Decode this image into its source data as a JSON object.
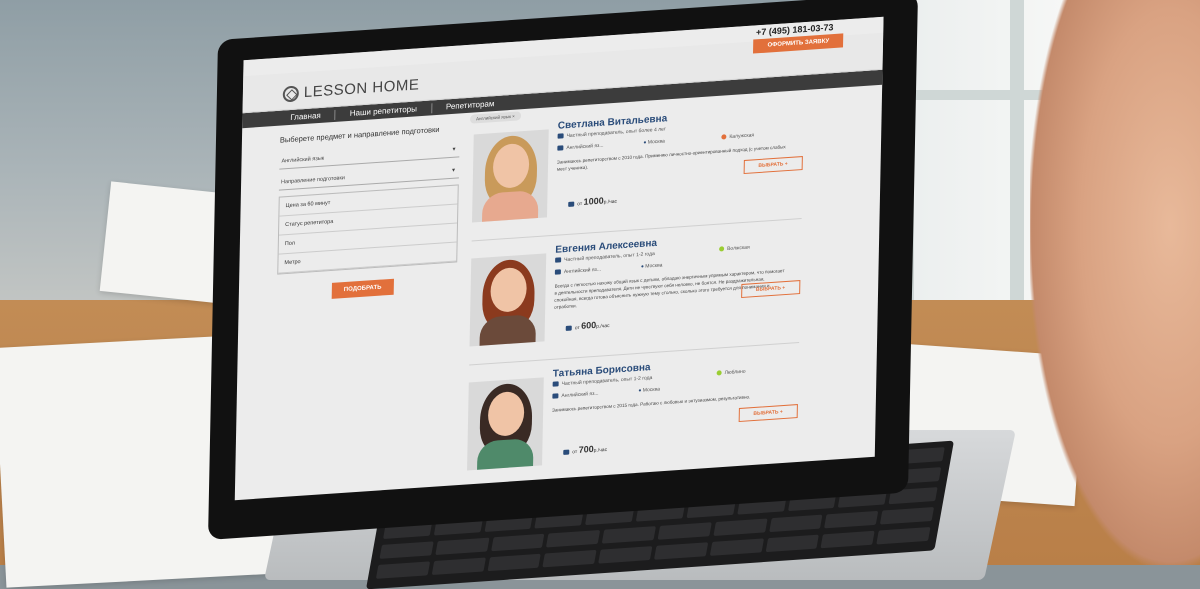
{
  "site": {
    "phone": "+7 (495) 181-03-73",
    "cta_label": "ОФОРМИТЬ ЗАЯВКУ",
    "logo_text": "LESSON HOME",
    "nav": [
      "Главная",
      "Наши репетиторы",
      "Репетиторам"
    ]
  },
  "filter": {
    "title": "Выберете предмет и направление подготовки",
    "subject_value": "Английский язык",
    "direction_placeholder": "Направление подготовки",
    "fields": [
      "Цена за 60 минут",
      "Статус репетитора",
      "Пол",
      "Метро"
    ],
    "submit_label": "ПОДОБРАТЬ",
    "chip_label": "Английский язык ×"
  },
  "tutors": [
    {
      "name": "Светлана Витальевна",
      "status": "Частный преподаватель, опыт более 4 лет",
      "subject": "Английский яз...",
      "city": "Москва",
      "metro": "Калужская",
      "metro_color": "#e2703b",
      "description": "Занимаюсь репетиторством с 2010 года. Применяю личностно-ориентированный подход (с учетом слабых мест ученика).",
      "price_prefix": "от",
      "price": "1000",
      "price_suffix": "р./час",
      "choose_label": "ВЫБРАТЬ +"
    },
    {
      "name": "Евгения Алексеевна",
      "status": "Частный преподаватель, опыт 1-2 года",
      "subject": "Английский яз...",
      "city": "Москва",
      "metro": "Волжская",
      "metro_color": "#9acd32",
      "description": "Всегда с легкостью нахожу общий язык с детьми, обладаю энергичным упрямым характером, что помогает в деятельности преподавателя. Дети не чувствуют себя неловко, не боятся. Не раздражительная, спокойная, всегда готова объяснить нужную тему столько, сколько этого требуется для понимания и отработки.",
      "price_prefix": "от",
      "price": "600",
      "price_suffix": "р./час",
      "choose_label": "ВЫБРАТЬ +"
    },
    {
      "name": "Татьяна Борисовна",
      "status": "Частный преподаватель, опыт 1-2 года",
      "subject": "Английский яз...",
      "city": "Москва",
      "metro": "Люблино",
      "metro_color": "#9acd32",
      "description": "Занимаюсь репетиторством с 2015 года. Работаю с любовью и энтузиазмом, результативно.",
      "price_prefix": "от",
      "price": "700",
      "price_suffix": "р./час",
      "choose_label": "ВЫБРАТЬ +"
    }
  ]
}
